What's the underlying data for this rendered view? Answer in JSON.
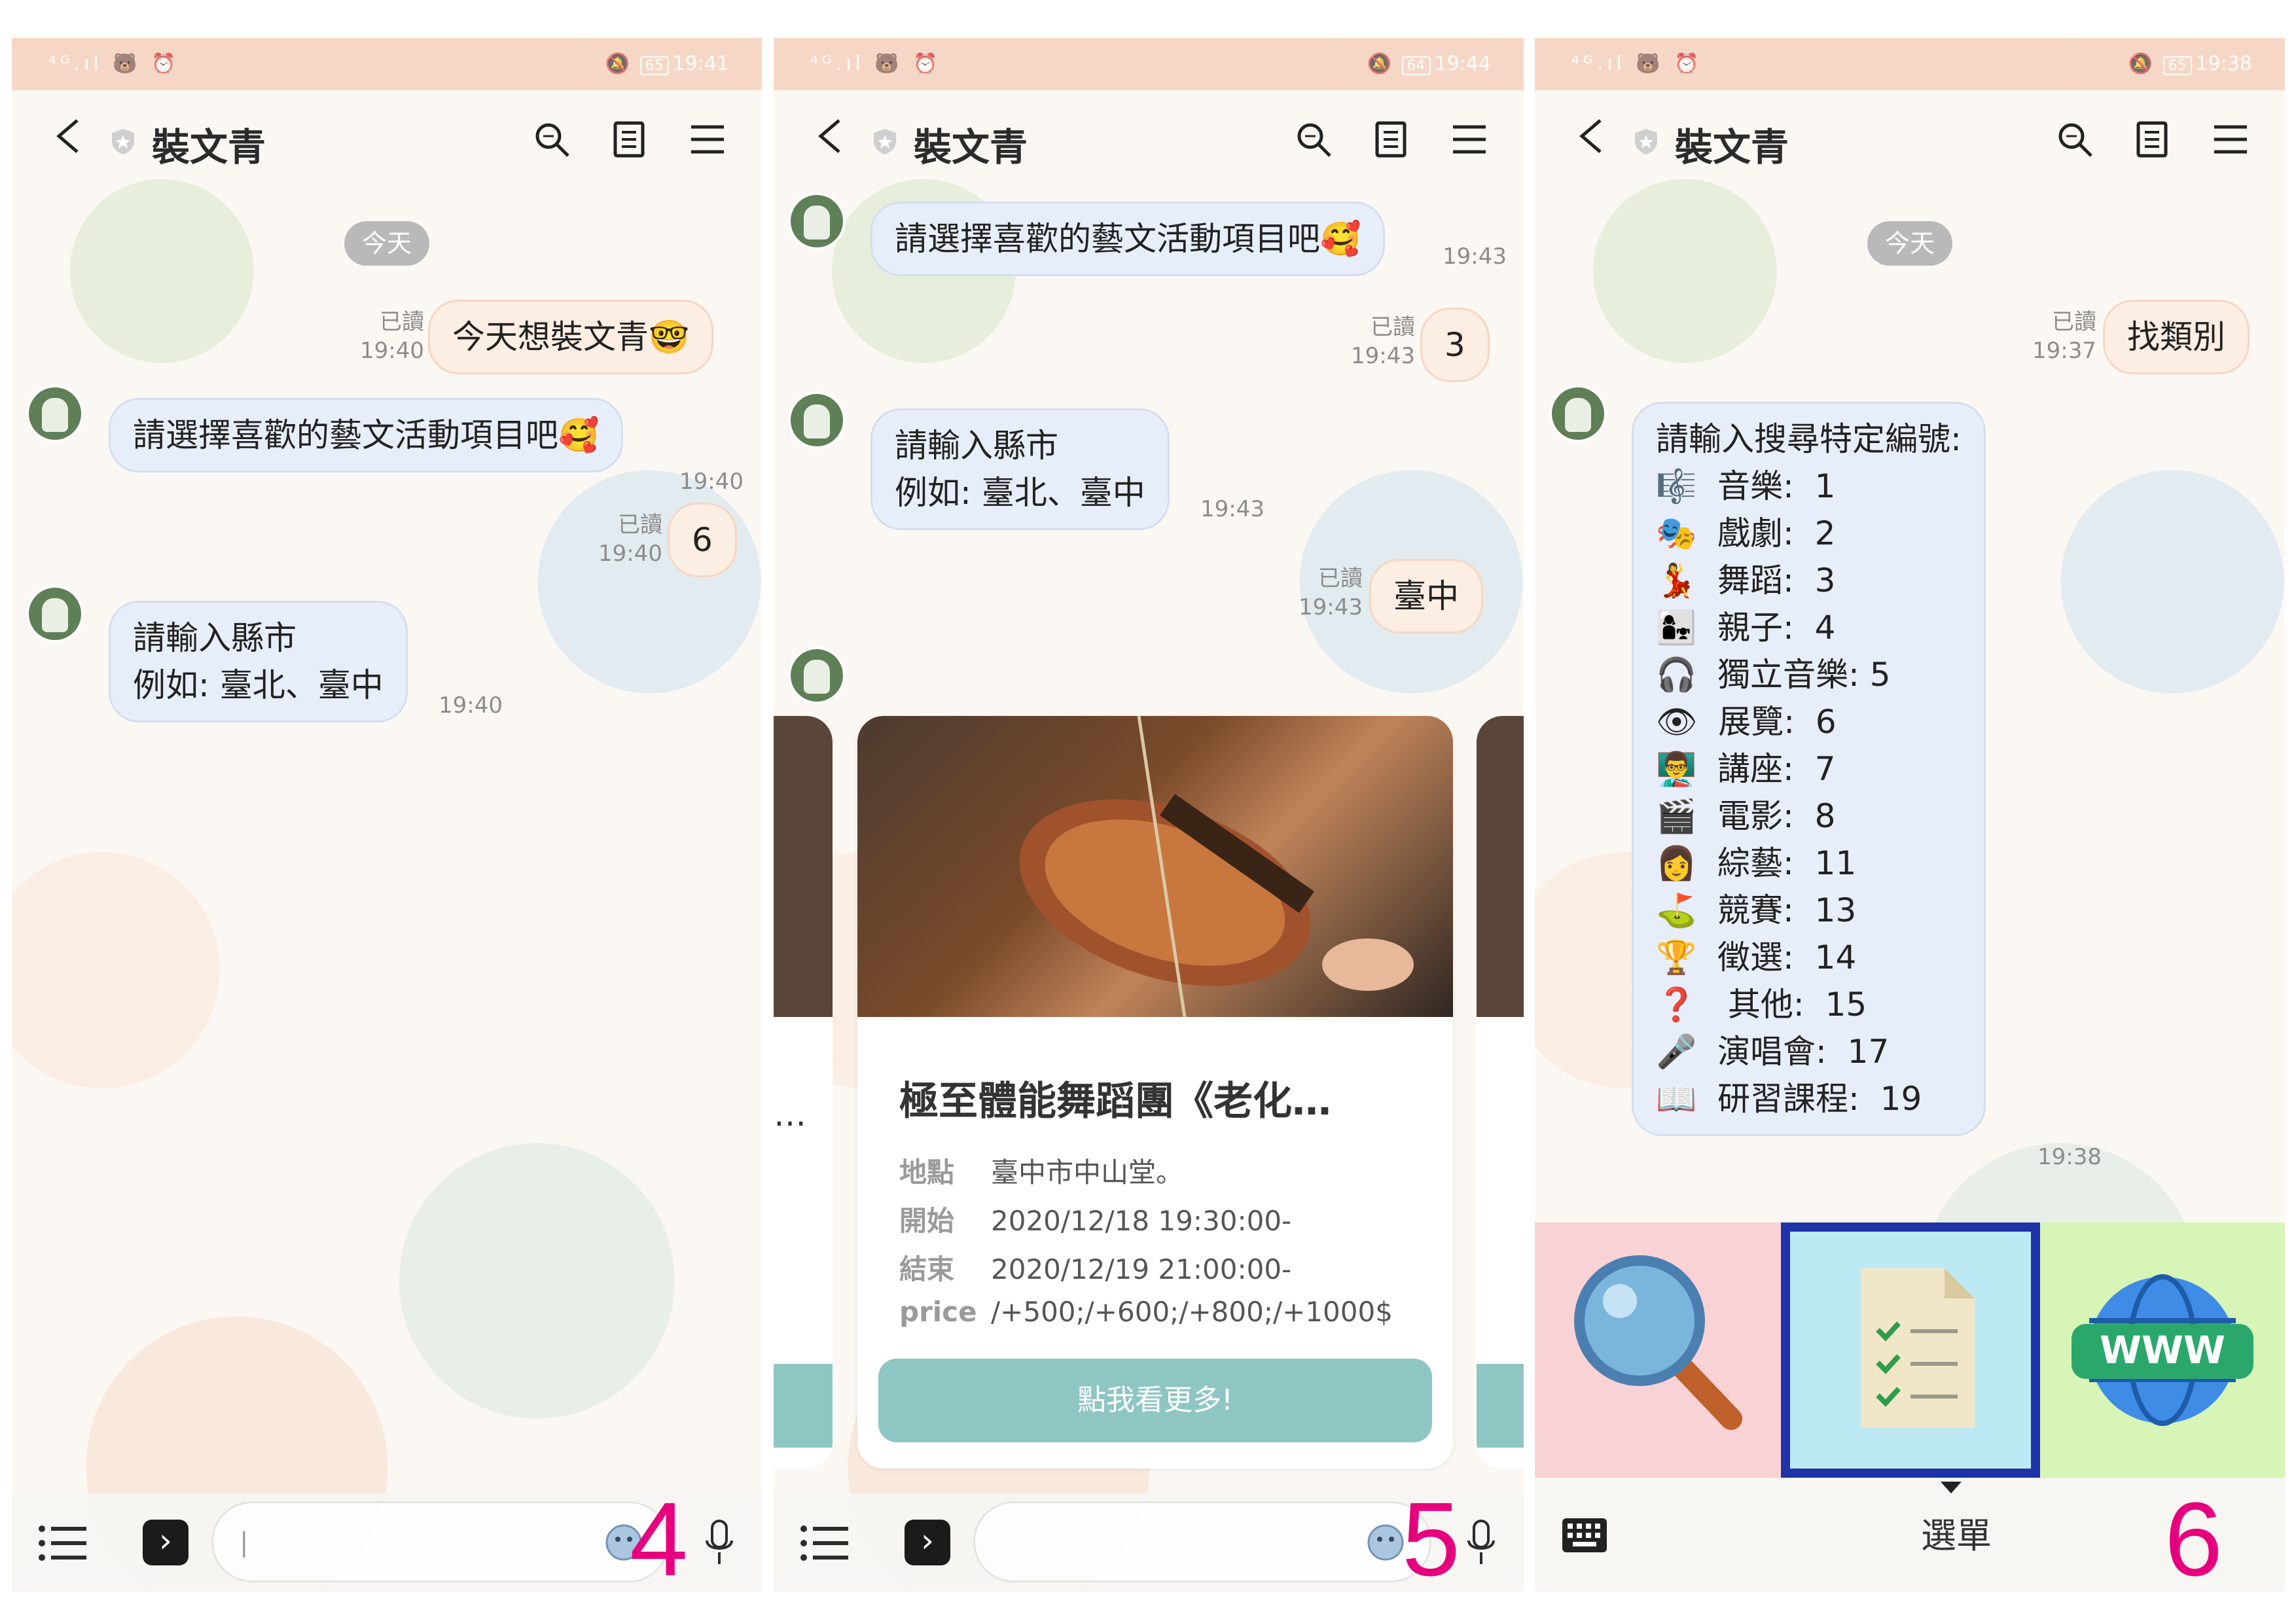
{
  "panel1": {
    "status": {
      "left": "⁴ᴳ.ıl 🐻 ⏰",
      "battery": "65",
      "time": "19:41"
    },
    "title": "裝文青",
    "date_pill": "今天",
    "messages": {
      "out1": {
        "text": "今天想裝文青🤓",
        "read": "已讀",
        "time": "19:40"
      },
      "in1": {
        "text": "請選擇喜歡的藝文活動項目吧🥰",
        "time": "19:40"
      },
      "out2": {
        "text": "6",
        "read": "已讀",
        "time": "19:40"
      },
      "in2": {
        "text": "請輸入縣市\n例如: 臺北、臺中",
        "time": "19:40"
      }
    },
    "step": "4"
  },
  "panel2": {
    "status": {
      "left": "⁴ᴳ.ıl 🐻 ⏰",
      "battery": "64",
      "time": "19:44"
    },
    "title": "裝文青",
    "messages": {
      "in1": {
        "text": "請選擇喜歡的藝文活動項目吧🥰",
        "time": "19:43"
      },
      "out1": {
        "text": "3",
        "read": "已讀",
        "time": "19:43"
      },
      "in2": {
        "text": "請輸入縣市\n例如: 臺北、臺中",
        "time": "19:43"
      },
      "out2": {
        "text": "臺中",
        "read": "已讀",
        "time": "19:43"
      }
    },
    "card": {
      "title": "極至體能舞蹈團《老化…",
      "rows": [
        {
          "key": "地點",
          "value": "臺中市中山堂。"
        },
        {
          "key": "開始",
          "value": "2020/12/18 19:30:00-"
        },
        {
          "key": "結束",
          "value": "2020/12/19 21:00:00-"
        },
        {
          "key": "price",
          "value": "/+500;/+600;/+800;/+1000$"
        }
      ],
      "button": "點我看更多!",
      "left_peek": "…"
    },
    "step": "5"
  },
  "panel3": {
    "status": {
      "left": "⁴ᴳ.ıl 🐻 ⏰",
      "battery": "65",
      "time": "19:38"
    },
    "title": "裝文青",
    "date_pill": "今天",
    "messages": {
      "out1": {
        "text": "找類別",
        "read": "已讀",
        "time": "19:37"
      },
      "in1": {
        "text": "請輸入搜尋特定編號:\n🎼  音樂:  1\n🎭  戲劇:  2\n💃  舞蹈:  3\n👩‍👧  親子:  4\n🎧  獨立音樂: 5\n👁  展覽:  6\n👨‍🏫  講座:  7\n🎬  電影:  8\n👩  綜藝:  11\n⛳  競賽:  13\n🏆  徵選:  14\n❓   其他:  15\n🎤  演唱會:  17\n📖  研習課程:  19",
        "time": "19:38"
      }
    },
    "rich_menu": {
      "label": "選單"
    },
    "step": "6"
  },
  "colors": {
    "step": "#e6007e",
    "highlight": "#1f33a8",
    "card_button": "#8ec6c3"
  }
}
